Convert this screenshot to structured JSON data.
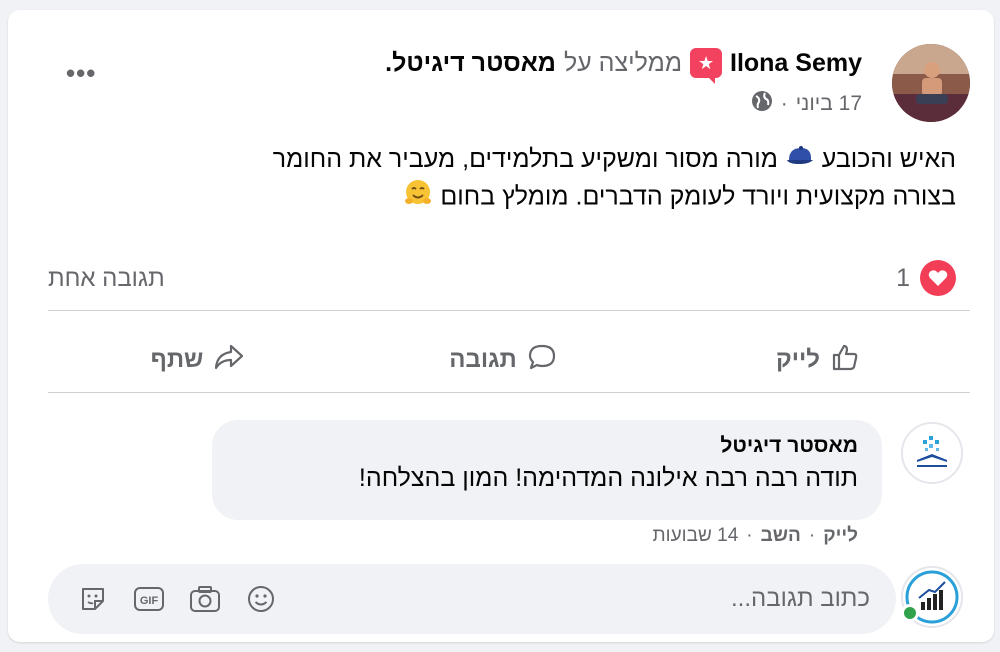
{
  "post": {
    "author_name": "Ilona Semy",
    "recommends_text": "ממליצה על",
    "page_name": "מאסטר דיגיטל",
    "period": ".",
    "date": "17 ביוני",
    "dot_separator": "·",
    "more_label": "•••",
    "text_line_1": "האיש והכובע",
    "text_line_1b": "מורה מסור ומשקיע בתלמידים, מעביר את החומר",
    "text_line_2": "בצורה מקצועית ויורד לעומק הדברים. מומלץ בחום",
    "reaction_count": "1",
    "comments_count": "תגובה אחת"
  },
  "actions": {
    "like": "לייק",
    "comment": "תגובה",
    "share": "שתף"
  },
  "comment": {
    "author": "מאסטר דיגיטל",
    "body": "תודה רבה רבה אילונה המדהימה! המון בהצלחה!",
    "like": "לייק",
    "reply": "השב",
    "time": "14 שבועות",
    "dot": "·"
  },
  "composer": {
    "placeholder": "כתוב תגובה..."
  },
  "colors": {
    "accent_heart": "#f33e58",
    "recommend_badge": "#f3425f",
    "online": "#31a24c",
    "secondary_text": "#65676b"
  },
  "icons": [
    "more-icon",
    "recommend-icon",
    "globe-icon",
    "cap-emoji",
    "hug-emoji",
    "heart-icon",
    "like-icon",
    "comment-icon",
    "share-icon",
    "smiley-icon",
    "camera-icon",
    "gif-icon",
    "sticker-icon"
  ]
}
